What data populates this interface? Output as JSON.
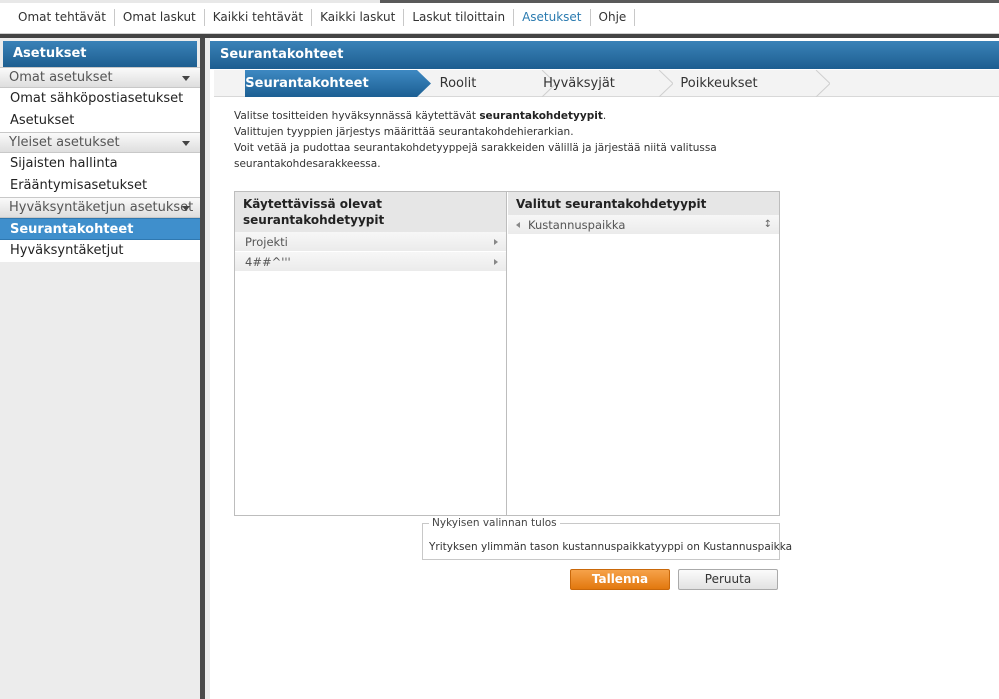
{
  "topnav": {
    "items": [
      "Omat tehtävät",
      "Omat laskut",
      "Kaikki tehtävät",
      "Kaikki laskut",
      "Laskut tiloittain",
      "Asetukset",
      "Ohje"
    ],
    "active_index": 5
  },
  "sidebar": {
    "title": "Asetukset",
    "groups": [
      {
        "label": "Omat asetukset",
        "items": [
          "Omat sähköpostiasetukset",
          "Asetukset"
        ]
      },
      {
        "label": "Yleiset asetukset",
        "items": [
          "Sijaisten hallinta",
          "Erääntymisasetukset"
        ]
      },
      {
        "label": "Hyväksyntäketjun asetukset",
        "items": [
          "Seurantakohteet",
          "Hyväksyntäketjut"
        ]
      }
    ],
    "active_item": "Seurantakohteet"
  },
  "main": {
    "title": "Seurantakohteet",
    "tabs": [
      "Seurantakohteet",
      "Roolit",
      "Hyväksyjät",
      "Poikkeukset"
    ],
    "active_tab": 0,
    "intro": {
      "line1_pre": "Valitse tositteiden hyväksynnässä käytettävät ",
      "line1_bold": "seurantakohdetyypit",
      "line1_post": ".",
      "line2": "Valittujen tyyppien järjestys määrittää seurantakohdehierarkian.",
      "line3": "Voit vetää ja pudottaa seurantakohdetyyppejä sarakkeiden välillä ja järjestää niitä valitussa",
      "line4": "seurantakohdesarakkeessa."
    },
    "available": {
      "header": "Käytettävissä olevat seurantakohdetyypit",
      "items": [
        "Projekti",
        "4##^'''"
      ]
    },
    "selected": {
      "header": "Valitut seurantakohdetyypit",
      "items": [
        "Kustannuspaikka"
      ]
    },
    "result": {
      "legend": "Nykyisen valinnan tulos",
      "text": "Yrityksen ylimmän tason kustannuspaikkatyyppi on Kustannuspaikka"
    },
    "buttons": {
      "save": "Tallenna",
      "cancel": "Peruuta"
    }
  },
  "colors": {
    "header_blue": "#2a6fa5",
    "active_item": "#3f8fcc",
    "save_orange": "#ec8a24",
    "nav_active": "#2b7bb0"
  }
}
